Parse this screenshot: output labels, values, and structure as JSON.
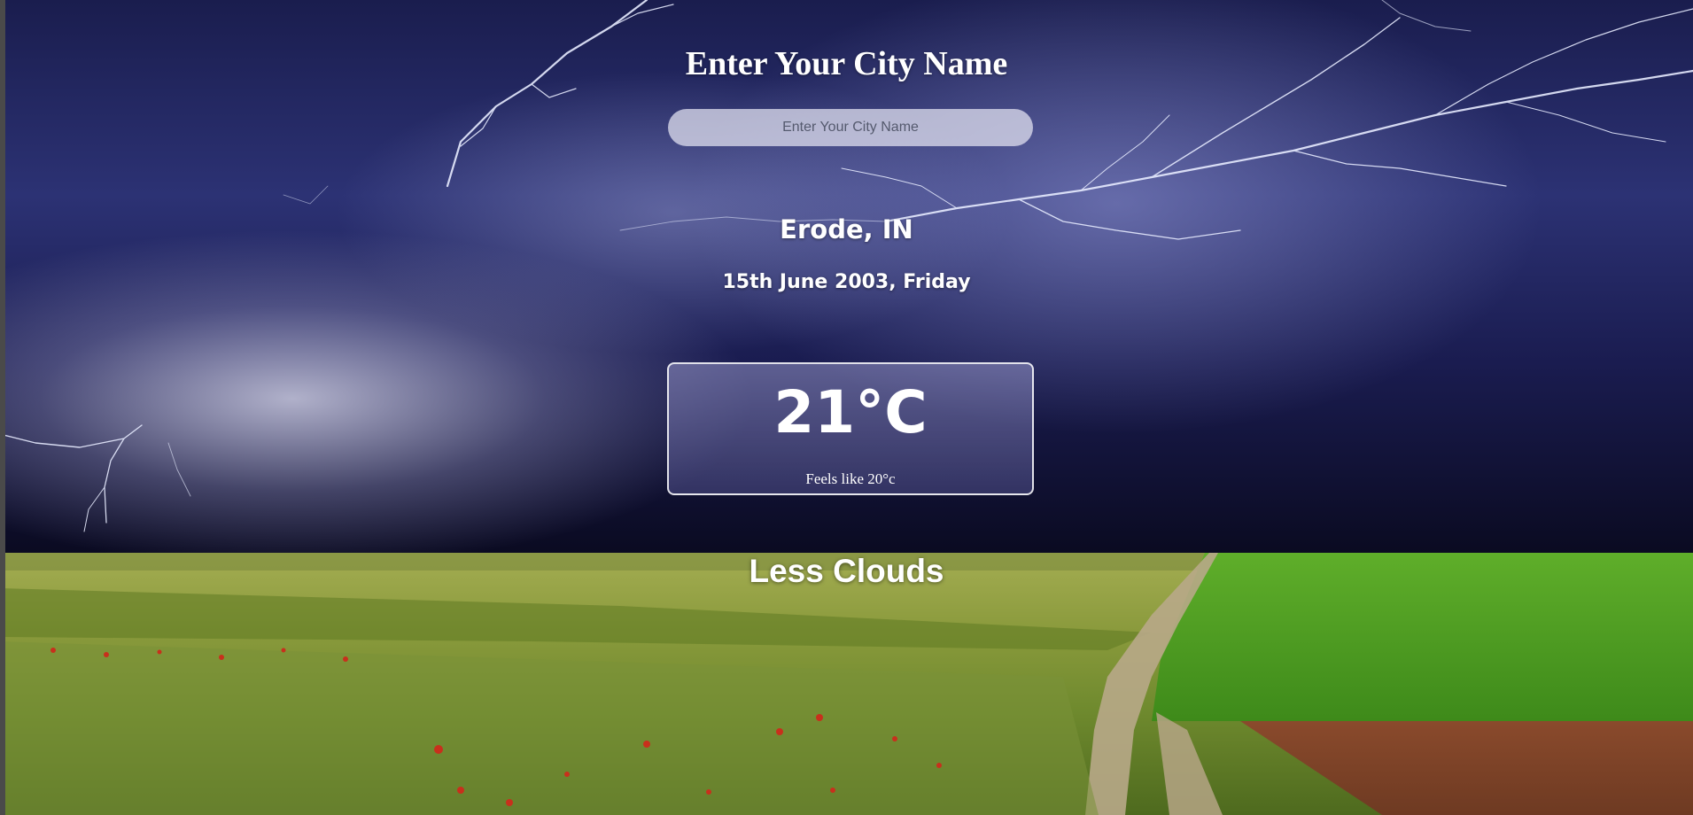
{
  "header": {
    "title": "Enter Your City Name"
  },
  "search": {
    "placeholder": "Enter Your City Name",
    "value": ""
  },
  "location": {
    "city": "Erode, IN",
    "date": "15th June 2003, Friday"
  },
  "weather": {
    "temperature": "21°C",
    "feels_like": "Feels like 20°c",
    "condition": "Less Clouds"
  },
  "background": {
    "image": "lightning storm over green fields with dirt road",
    "sky_color": "#1a1d4e",
    "field_color": "#6a9a2a"
  }
}
